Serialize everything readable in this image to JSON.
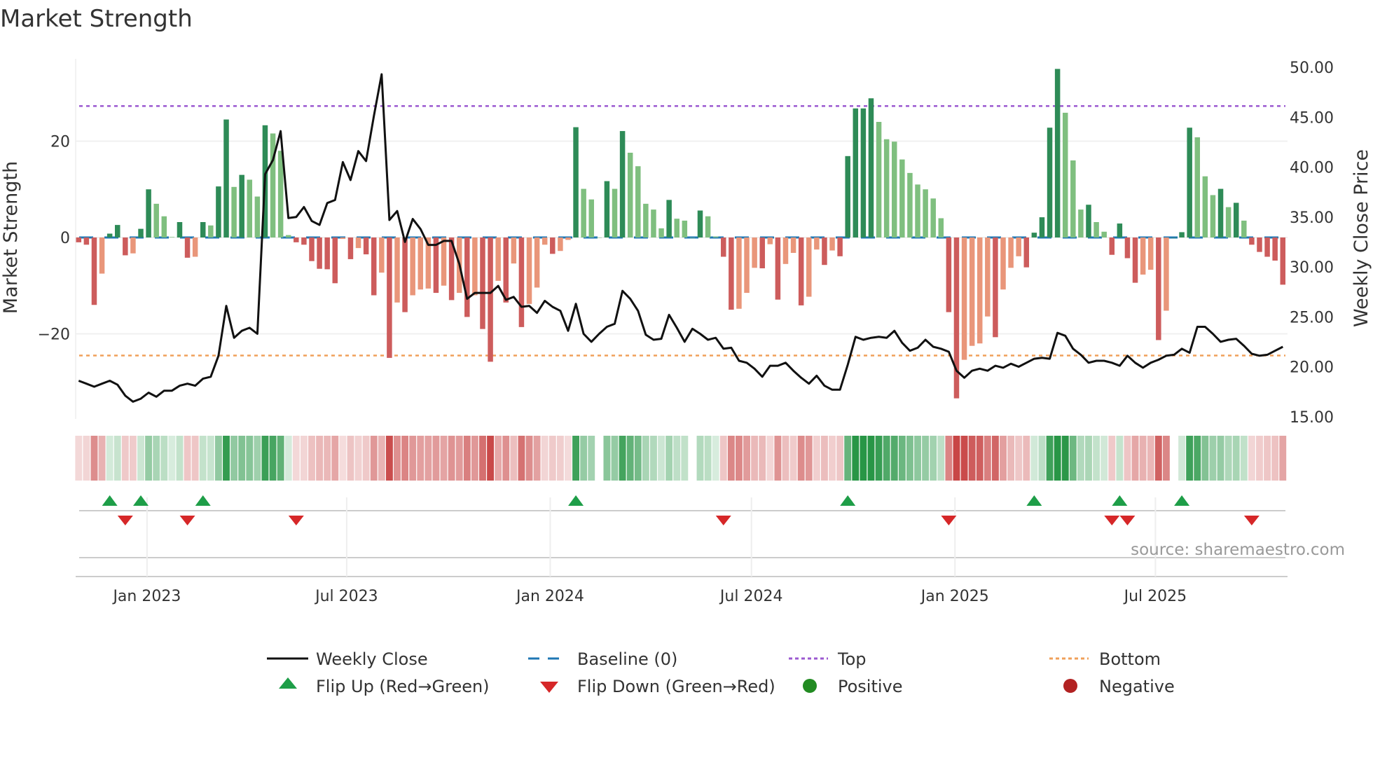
{
  "chart_data": {
    "type": "bar+line",
    "title": "Market Strength",
    "ylabel": "Market Strength",
    "y2label": "Weekly Close Price",
    "ylim": [
      -37,
      38
    ],
    "y2lim": [
      14,
      51
    ],
    "frequency": "weekly",
    "yticks": [
      {
        "value": 20,
        "label": "20"
      },
      {
        "value": 0,
        "label": "0"
      },
      {
        "value": -20,
        "label": "−20"
      }
    ],
    "y2ticks": [
      {
        "value": 50,
        "label": "50.00"
      },
      {
        "value": 45,
        "label": "45.00"
      },
      {
        "value": 40,
        "label": "40.00"
      },
      {
        "value": 35,
        "label": "35.00"
      },
      {
        "value": 30,
        "label": "30.00"
      },
      {
        "value": 25,
        "label": "25.00"
      },
      {
        "value": 20,
        "label": "20.00"
      },
      {
        "value": 15,
        "label": "15.00"
      }
    ],
    "xticks": [
      {
        "week": 8.8,
        "label": "Jan 2023"
      },
      {
        "week": 34.5,
        "label": "Jul 2023"
      },
      {
        "week": 60.7,
        "label": "Jan 2024"
      },
      {
        "week": 86.6,
        "label": "Jul 2024"
      },
      {
        "week": 112.8,
        "label": "Jan 2025"
      },
      {
        "week": 138.6,
        "label": "Jul 2025"
      }
    ],
    "top_level": 27.3,
    "bottom_level": -24.5,
    "baseline": 0,
    "strength": [
      -1,
      -1.5,
      -14,
      -7.5,
      0.8,
      2.6,
      -3.7,
      -3.3,
      1.8,
      10,
      7,
      4.4,
      0.1,
      3.2,
      -4.2,
      -4,
      3.2,
      2.5,
      10.6,
      24.5,
      10.5,
      13,
      12,
      8.5,
      23.3,
      21.6,
      18,
      0.5,
      -1,
      -1.5,
      -4.9,
      -6.5,
      -6.6,
      -9.5,
      -0.3,
      -4.5,
      -2.2,
      -3.5,
      -12,
      -7.3,
      -25,
      -13.5,
      -15.5,
      -12,
      -10.8,
      -10.6,
      -11.5,
      -10,
      -13,
      -11.5,
      -16.5,
      -12,
      -19,
      -25.8,
      -9,
      -13.5,
      -5.4,
      -18.6,
      -13.8,
      -10.4,
      -1.5,
      -3.4,
      -2.8,
      -0.5,
      22.9,
      10.1,
      7.9,
      0,
      11.7,
      10.1,
      22.1,
      17.6,
      14.8,
      7,
      5.8,
      1.9,
      7.8,
      3.9,
      3.5,
      0,
      5.6,
      4.4,
      0.2,
      -4,
      -15,
      -14.8,
      -11.5,
      -6.3,
      -6.4,
      -1.4,
      -12.9,
      -5.5,
      -3.2,
      -14.1,
      -12.3,
      -2.5,
      -5.7,
      -2.7,
      -3.9,
      16.9,
      26.8,
      26.8,
      28.9,
      24,
      20.4,
      19.9,
      16.2,
      13.4,
      11,
      10,
      8.1,
      4,
      -15.5,
      -33.4,
      -25.4,
      -22.5,
      -22,
      -16.4,
      -20.7,
      -10.8,
      -6.3,
      -3.9,
      -6.2,
      1,
      4.2,
      22.8,
      35,
      25.9,
      16,
      5.8,
      6.8,
      3.2,
      1.2,
      -3.6,
      2.9,
      -4.3,
      -9.4,
      -7.7,
      -6.7,
      -21.3,
      -15.2,
      0,
      1.1,
      22.8,
      20.8,
      12.7,
      8.8,
      10.1,
      6.3,
      7.2,
      3.5,
      -1.5,
      -3,
      -4,
      -4.8,
      -9.8
    ],
    "weekly_close": [
      18.6,
      18.3,
      18.0,
      18.3,
      18.6,
      18.2,
      17.1,
      16.5,
      16.8,
      17.4,
      17.0,
      17.6,
      17.6,
      18.1,
      18.3,
      18.1,
      18.8,
      19.0,
      21.1,
      26.1,
      22.9,
      23.6,
      23.9,
      23.3,
      39.3,
      40.7,
      43.6,
      34.9,
      35.0,
      36.0,
      34.6,
      34.2,
      36.4,
      36.7,
      40.5,
      38.7,
      41.6,
      40.6,
      45.1,
      49.3,
      34.7,
      35.6,
      32.5,
      34.8,
      33.8,
      32.2,
      32.2,
      32.6,
      32.6,
      30.3,
      26.8,
      27.4,
      27.4,
      27.4,
      28.1,
      26.7,
      27.0,
      26.0,
      26.1,
      25.4,
      26.6,
      26.0,
      25.6,
      23.6,
      26.3,
      23.3,
      22.5,
      23.3,
      24.0,
      24.3,
      27.6,
      26.8,
      25.6,
      23.2,
      22.7,
      22.8,
      25.2,
      23.9,
      22.5,
      23.8,
      23.3,
      22.7,
      22.9,
      21.8,
      21.9,
      20.6,
      20.4,
      19.8,
      19.0,
      20.1,
      20.1,
      20.4,
      19.6,
      18.9,
      18.3,
      19.1,
      18.1,
      17.7,
      17.7,
      20.2,
      23.0,
      22.7,
      22.9,
      23.0,
      22.9,
      23.6,
      22.4,
      21.6,
      21.9,
      22.7,
      22.0,
      21.8,
      21.5,
      19.6,
      18.9,
      19.6,
      19.8,
      19.6,
      20.1,
      19.9,
      20.3,
      20.0,
      20.4,
      20.8,
      20.9,
      20.8,
      23.4,
      23.1,
      21.8,
      21.2,
      20.4,
      20.6,
      20.6,
      20.4,
      20.1,
      21.1,
      20.4,
      19.9,
      20.4,
      20.7,
      21.1,
      21.2,
      21.8,
      21.4,
      24.0,
      24.0,
      23.3,
      22.5,
      22.7,
      22.8,
      22.1,
      21.3,
      21.1,
      21.2,
      21.6,
      22.0
    ],
    "flip_up_weeks": [
      4,
      8,
      16,
      64,
      99,
      123,
      134,
      142
    ],
    "flip_down_weeks": [
      6,
      14,
      28,
      83,
      112,
      133,
      135,
      151
    ],
    "legend": {
      "placement": "bottom",
      "entries": [
        "Weekly Close",
        "Baseline (0)",
        "Top",
        "Bottom",
        "Flip Up (Red→Green)",
        "Flip Down (Green→Red)",
        "Positive",
        "Negative"
      ]
    },
    "source": "source: sharemaestro.com"
  },
  "colors": {
    "pos_rising": "#2e8b57",
    "pos_falling": "#7fbf7f",
    "neg_falling": "#cd5c5c",
    "neg_rising": "#e9967a",
    "line": "#111111",
    "baseline": "#1f77b4",
    "top": "#9b59d0",
    "bottom": "#f0a05a",
    "flip_up": "#1e9e48",
    "flip_down": "#d62728",
    "positive": "#228b22",
    "negative": "#b22222"
  }
}
